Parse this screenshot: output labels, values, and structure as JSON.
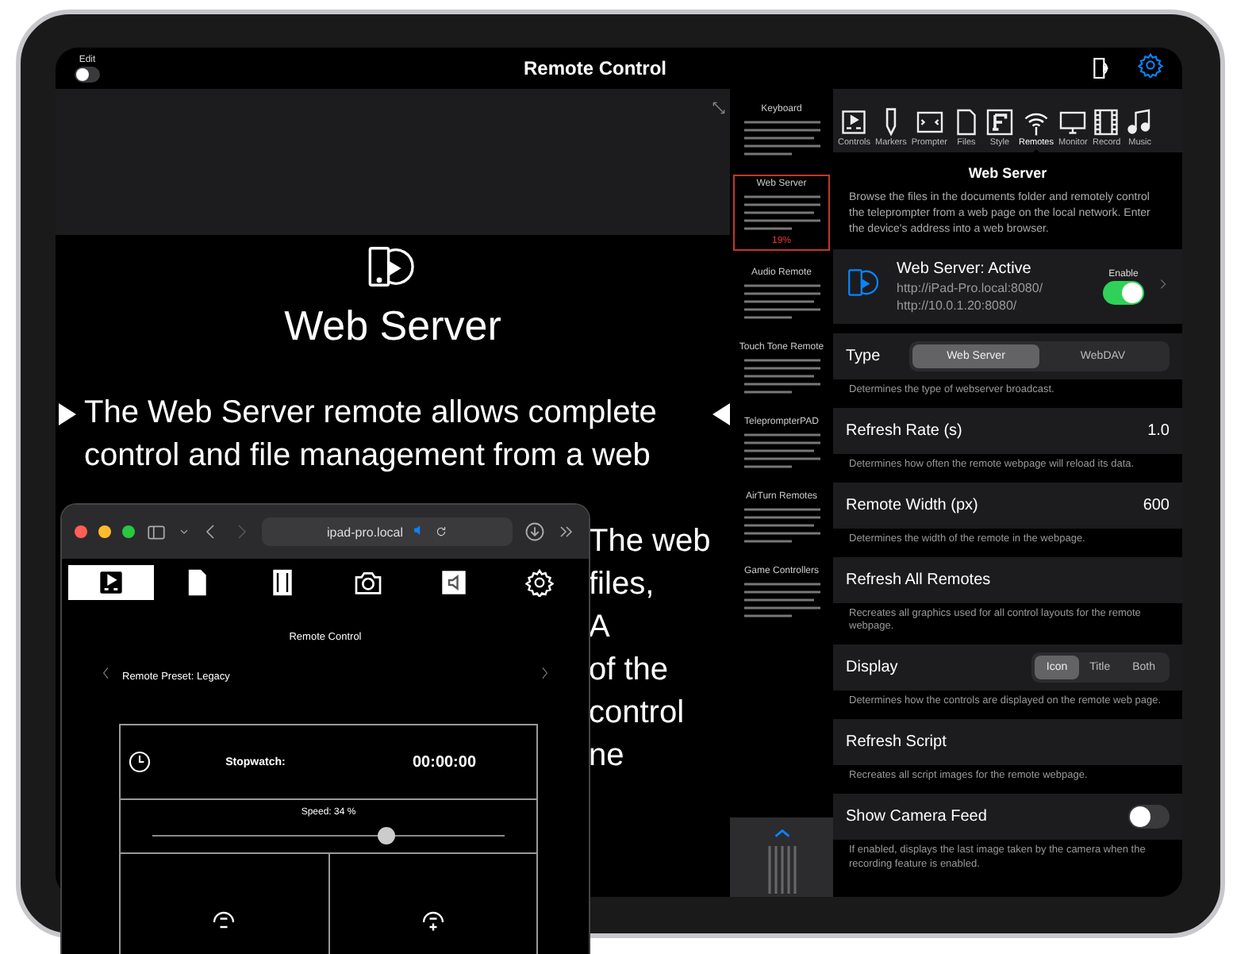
{
  "top_bar": {
    "edit_label": "Edit",
    "edit_on": false,
    "title": "Remote Control"
  },
  "prompter": {
    "title": "Web Server",
    "lines": [
      "The Web Server remote allows complete",
      "control and file management from a web"
    ],
    "fragments": [
      "The web",
      "files,",
      "A",
      "of the",
      "control",
      "ne"
    ]
  },
  "script_outline": {
    "sections": [
      {
        "heading": "Keyboard",
        "highlighted": false
      },
      {
        "heading": "Web Server",
        "highlighted": true,
        "marker": "19%"
      },
      {
        "heading": "Audio Remote",
        "highlighted": false
      },
      {
        "heading": "Touch Tone Remote",
        "highlighted": false
      },
      {
        "heading": "TeleprompterPAD",
        "highlighted": false
      },
      {
        "heading": "AirTurn Remotes",
        "highlighted": false
      },
      {
        "heading": "Game Controllers",
        "highlighted": false
      }
    ]
  },
  "toolbar": [
    {
      "kind": "controls",
      "label": "Controls",
      "selected": false
    },
    {
      "kind": "markers",
      "label": "Markers",
      "selected": false
    },
    {
      "kind": "prompter",
      "label": "Prompter",
      "selected": false
    },
    {
      "kind": "files",
      "label": "Files",
      "selected": false
    },
    {
      "kind": "style",
      "label": "Style",
      "selected": false
    },
    {
      "kind": "remotes",
      "label": "Remotes",
      "selected": true
    },
    {
      "kind": "monitor",
      "label": "Monitor",
      "selected": false
    },
    {
      "kind": "record",
      "label": "Record",
      "selected": false
    },
    {
      "kind": "music",
      "label": "Music",
      "selected": false
    }
  ],
  "settings": {
    "title": "Web Server",
    "description": "Browse the files in the documents folder and remotely control the teleprompter from a web page on the local network.  Enter the device's address into a web browser.",
    "server": {
      "status": "Web Server: Active",
      "urls": [
        "http://iPad-Pro.local:8080/",
        "http://10.0.1.20:8080/"
      ],
      "enable_label": "Enable",
      "enabled": true
    },
    "rows": [
      {
        "kind": "segmented",
        "label": "Type",
        "options": [
          {
            "label": "Web Server",
            "selected": true
          },
          {
            "label": "WebDAV",
            "selected": false
          }
        ],
        "hint": "Determines the type of webserver broadcast."
      },
      {
        "kind": "value",
        "label": "Refresh Rate (s)",
        "value": "1.0",
        "hint": "Determines how often the remote webpage will reload its data."
      },
      {
        "kind": "value",
        "label": "Remote Width (px)",
        "value": "600",
        "hint": "Determines the width of the remote in the webpage."
      },
      {
        "kind": "action",
        "label": "Refresh All Remotes",
        "hint": "Recreates all graphics used for all control layouts for the remote webpage."
      },
      {
        "kind": "segmented",
        "label": "Display",
        "options": [
          {
            "label": "Icon",
            "selected": true
          },
          {
            "label": "Title",
            "selected": false
          },
          {
            "label": "Both",
            "selected": false
          }
        ],
        "hint": "Determines how the controls are displayed on the remote web page."
      },
      {
        "kind": "action",
        "label": "Refresh Script",
        "hint": "Recreates all script images for the remote webpage."
      },
      {
        "kind": "toggle",
        "label": "Show Camera Feed",
        "on": false,
        "hint": "If enabled, displays the last image taken by the camera when the recording feature is enabled."
      }
    ]
  },
  "browser": {
    "address": "ipad-pro.local",
    "tabs": [
      {
        "kind": "controls",
        "selected": true
      },
      {
        "kind": "file",
        "selected": false
      },
      {
        "kind": "film",
        "selected": false
      },
      {
        "kind": "camera",
        "selected": false
      },
      {
        "kind": "audio",
        "selected": false
      },
      {
        "kind": "gear",
        "selected": false
      }
    ],
    "page_title": "Remote Control",
    "preset": "Remote Preset: Legacy",
    "stopwatch_label": "Stopwatch:",
    "stopwatch_value": "00:00:00",
    "speed_label": "Speed: 34 %",
    "speed": {
      "level": 0.66
    }
  }
}
